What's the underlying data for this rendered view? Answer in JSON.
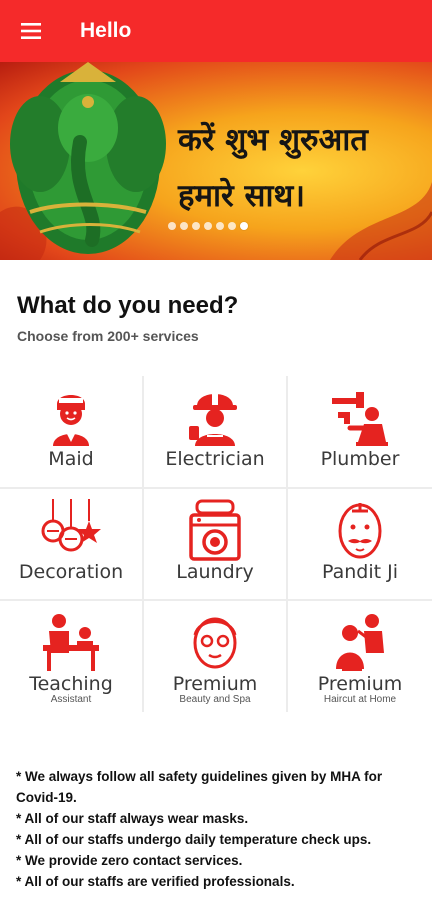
{
  "app": {
    "title": "Hello",
    "menu_icon": "hamburger-icon"
  },
  "banner": {
    "line1": "करें शुभ शुरुआत",
    "line2": "हमारे साथ।",
    "slides": 7,
    "active_slide": 7
  },
  "section": {
    "title": "What do you need?",
    "subtitle": "Choose from 200+ services"
  },
  "services": [
    {
      "label": "Maid",
      "sub": "",
      "icon": "maid-icon"
    },
    {
      "label": "Electrician",
      "sub": "",
      "icon": "electrician-icon"
    },
    {
      "label": "Plumber",
      "sub": "",
      "icon": "plumber-icon"
    },
    {
      "label": "Decoration",
      "sub": "",
      "icon": "decoration-icon"
    },
    {
      "label": "Laundry",
      "sub": "",
      "icon": "laundry-icon"
    },
    {
      "label": "Pandit Ji",
      "sub": "",
      "icon": "pandit-icon"
    },
    {
      "label": "Teaching",
      "sub": "Assistant",
      "icon": "teaching-icon"
    },
    {
      "label": "Premium",
      "sub": "Beauty and Spa",
      "icon": "beauty-spa-icon"
    },
    {
      "label": "Premium",
      "sub": "Haircut at Home",
      "icon": "haircut-icon"
    }
  ],
  "notes": [
    "* We always follow all safety guidelines given by MHA for Covid-19.",
    "* All of our staff always wear masks.",
    "* All of our staffs undergo daily temperature check ups.",
    "* We provide zero contact services.",
    "* All of our staffs are verified professionals."
  ],
  "colors": {
    "primary": "#f52a2a",
    "icon_red": "#e52320"
  }
}
